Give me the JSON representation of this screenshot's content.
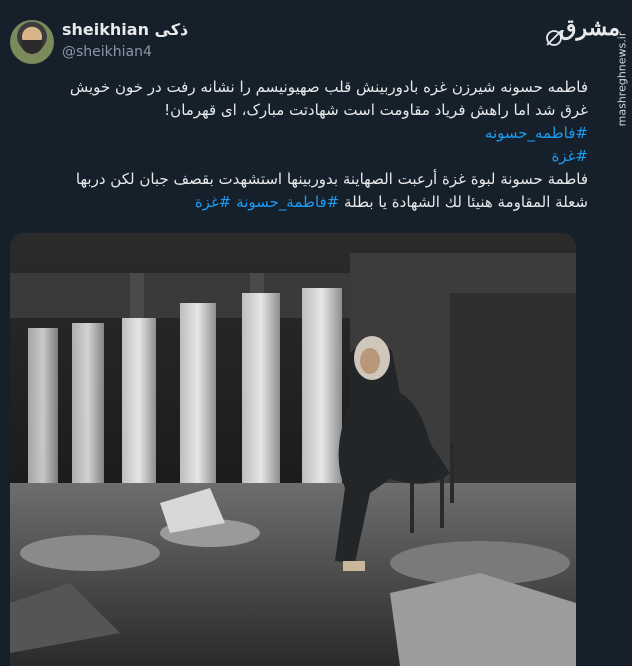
{
  "tweet": {
    "author": {
      "display_name": "sheikhian ذکی",
      "handle": "@sheikhian4",
      "avatar": "avatar"
    },
    "icons": {
      "grok": "grok-icon"
    },
    "site": {
      "logo_text": "مشرق",
      "watermark": "mashreghnews.ir"
    },
    "text": {
      "persian_line1": "فاطمه حسونه شیرزن غزه بادوربینش قلب صهیونیسم را نشانه رفت در خون خویش",
      "persian_line2": "غرق شد اما راهش فریاد مقاومت است شهادتت مبارک، ای قهرمان!",
      "hashtag1": "#فاطمه_حسونه",
      "hashtag2": "#غزة",
      "arabic_line1": "فاطمة حسونة لبوة غزة أرعبت الصهاينة بدوربينها استشهدت بقصف جبان لكن دربها",
      "arabic_line2_text": "شعلة المقاومة هنيئا لك الشهادة يا بطلة ",
      "hashtag3": "#فاطمة_حسونة",
      "hashtag4": "#غزة"
    },
    "media": {
      "image": "photo"
    }
  }
}
